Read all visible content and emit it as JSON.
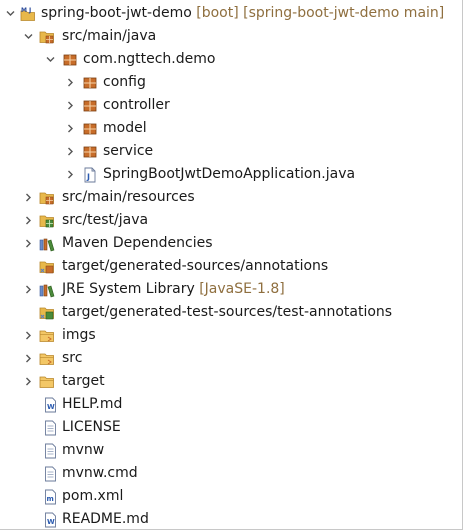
{
  "tree": {
    "project": {
      "name": "spring-boot-jwt-demo",
      "decoration": "[boot] [spring-boot-jwt-demo main]",
      "icon": "maven-project-icon"
    },
    "src_main_java": {
      "label": "src/main/java",
      "icon": "source-folder-icon"
    },
    "package": {
      "label": "com.ngttech.demo",
      "icon": "package-icon"
    },
    "subpackages": [
      {
        "label": "config",
        "icon": "package-icon"
      },
      {
        "label": "controller",
        "icon": "package-icon"
      },
      {
        "label": "model",
        "icon": "package-icon"
      },
      {
        "label": "service",
        "icon": "package-icon"
      }
    ],
    "java_file": {
      "label": "SpringBootJwtDemoApplication.java",
      "icon": "java-file-icon"
    },
    "src_main_resources": {
      "label": "src/main/resources",
      "icon": "source-folder-icon"
    },
    "src_test_java": {
      "label": "src/test/java",
      "icon": "test-source-folder-icon"
    },
    "maven_deps": {
      "label": "Maven Dependencies",
      "icon": "library-icon"
    },
    "generated_sources": {
      "label": "target/generated-sources/annotations",
      "icon": "generated-source-folder-icon"
    },
    "jre": {
      "label": "JRE System Library",
      "decoration": "[JavaSE-1.8]",
      "icon": "library-icon"
    },
    "generated_test_sources": {
      "label": "target/generated-test-sources/test-annotations",
      "icon": "generated-test-source-folder-icon"
    },
    "folders": [
      {
        "label": "imgs",
        "icon": "folder-icon"
      },
      {
        "label": "src",
        "icon": "folder-icon"
      },
      {
        "label": "target",
        "icon": "folder-icon"
      }
    ],
    "files": [
      {
        "label": "HELP.md",
        "icon": "markdown-file-icon"
      },
      {
        "label": "LICENSE",
        "icon": "text-file-icon"
      },
      {
        "label": "mvnw",
        "icon": "text-file-icon"
      },
      {
        "label": "mvnw.cmd",
        "icon": "text-file-icon"
      },
      {
        "label": "pom.xml",
        "icon": "xml-file-icon"
      },
      {
        "label": "README.md",
        "icon": "markdown-file-icon"
      }
    ]
  },
  "colors": {
    "decoration": "#8f6f3f",
    "package": "#b5651d",
    "folder": "#e8b84a",
    "source_folder_accent": "#5b7fbf"
  }
}
